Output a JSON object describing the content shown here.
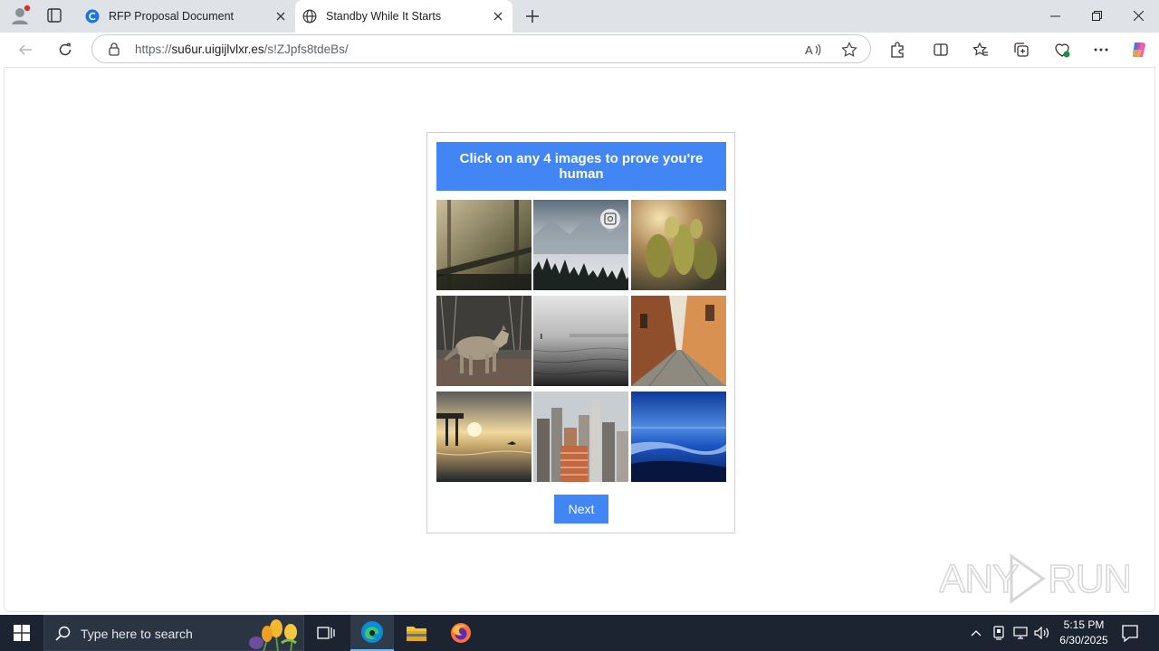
{
  "browser": {
    "tabs": [
      {
        "title": "RFP Proposal Document",
        "active": false
      },
      {
        "title": "Standby While It Starts",
        "active": true
      }
    ],
    "address": {
      "scheme": "https://",
      "host": "su6ur.uigijlvlxr.es",
      "path": "/s!ZJpfs8tdeBs/"
    }
  },
  "captcha": {
    "instruction": "Click on any 4 images to prove you're human",
    "images": [
      {
        "id": "tile-1",
        "subject": "foggy-forest-bridge"
      },
      {
        "id": "tile-2",
        "subject": "misty-mountains"
      },
      {
        "id": "tile-3",
        "subject": "cactus-sunlight"
      },
      {
        "id": "tile-4",
        "subject": "coyote"
      },
      {
        "id": "tile-5",
        "subject": "foggy-lake"
      },
      {
        "id": "tile-6",
        "subject": "narrow-alley"
      },
      {
        "id": "tile-7",
        "subject": "pier-sunset"
      },
      {
        "id": "tile-8",
        "subject": "city-skyline"
      },
      {
        "id": "tile-9",
        "subject": "blue-beach"
      }
    ],
    "next_label": "Next"
  },
  "watermark": "ANY RUN",
  "taskbar": {
    "search_placeholder": "Type here to search",
    "time": "5:15 PM",
    "date": "6/30/2025"
  },
  "colors": {
    "accent": "#4285f4",
    "taskbar": "#1c2331",
    "tabstrip": "#dfe3e8"
  }
}
